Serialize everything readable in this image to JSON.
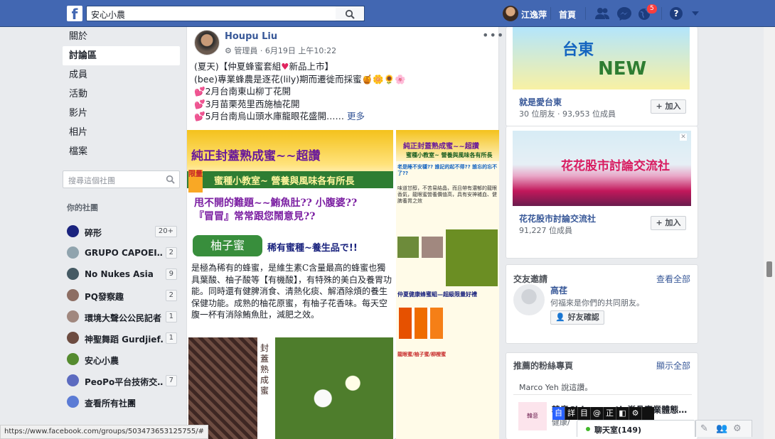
{
  "topbar": {
    "logo": "f",
    "search_value": "安心小農",
    "user_name": "江逸萍",
    "home_label": "首頁",
    "notification_count": "5",
    "help": "?"
  },
  "sidebar": {
    "items": [
      {
        "label": "關於"
      },
      {
        "label": "討論區"
      },
      {
        "label": "成員"
      },
      {
        "label": "活動"
      },
      {
        "label": "影片"
      },
      {
        "label": "相片"
      },
      {
        "label": "檔案"
      }
    ],
    "group_search_placeholder": "搜尋這個社團",
    "your_groups_title": "你的社團",
    "groups": [
      {
        "label": "碎形",
        "count": "20+",
        "color": "#1a237e"
      },
      {
        "label": "GRUPO CAPOEI…",
        "count": "2",
        "color": "#90a4ae"
      },
      {
        "label": "No Nukes Asia",
        "count": "9",
        "color": "#455a64"
      },
      {
        "label": "PQ發察趣",
        "count": "2",
        "color": "#8d6e63"
      },
      {
        "label": "環境大聲公公民記者",
        "count": "1",
        "color": "#a1887f"
      },
      {
        "label": "神聖舞蹈 Gurdjief…",
        "count": "1",
        "color": "#6d4c41"
      },
      {
        "label": "安心小農",
        "count": "",
        "color": "#558b2f"
      },
      {
        "label": "PeoPo平台技術交…",
        "count": "7",
        "color": "#5c6bc0"
      },
      {
        "label": "查看所有社團",
        "count": "",
        "color": "#5b7bd5"
      }
    ]
  },
  "post": {
    "author": "Houpu Liu",
    "role": "管理員",
    "date": "6月19日 上午10:22",
    "lines": [
      "(夏天)【仲夏蜂蜜套組",
      "新品上市】",
      "(bee)專業蜂農是逐花(lily)期而遷徙而採蜜🍯🌼🌻🌸",
      "2月台南東山柳丁花開",
      "3月苗栗苑里西施柚花開",
      "5月台南烏山頭水庫龍眼花盛開……"
    ],
    "more": "更多",
    "image": {
      "title": "純正封蓋熟成蜜~~超讚",
      "limit": "限量",
      "banner": "蜜種小教室~ 營養與風味各有所長",
      "line1": "甩不開的難題~~鮪魚肚?? 小腹婆??",
      "line2": "『冒冒』常常跟您鬧意見??",
      "tag": "柚子蜜",
      "rare": "稀有蜜種~養生品で!!",
      "body": "是極為稀有的蜂蜜，是維生素C含量最高的蜂蜜也獨具葉酸、柚子酸等【有機酸】，有特殊的美白及養胃功能。同時還有健脾消食、清熱化痰、解酒除煩的養生保健功能。成熟的柚花原蜜，有柚子花香味。每天空腹一杯有消除鮪魚肚，減肥之效。",
      "seal": "封蓋熟成蜜",
      "side_title": "純正封蓋熟成蜜~~超讚",
      "side_sub": "蜜種小教室~ 營養與風味各有所長",
      "side_q": "老是睡不安穩?? 誰記的起不得?? 誰忘的忘不了??",
      "side_body": "味道甘醇，不苦易結晶，而且帶有濃郁的龍眼香氣，龍眼蜜營養價值高，具有安神補血、健脾養胃之效",
      "side_title2": "仲夏健康蜂蜜組—超級限量好禮",
      "side_combo": "龍眼蜜/柚子蜜/柳橙蜜"
    }
  },
  "right": {
    "ads": [
      {
        "name": "就是愛台東",
        "sub": "30 位朋友 · 93,953 位成員",
        "add": "+ 加入",
        "banner_title": "台東",
        "banner_sub": "NEW"
      },
      {
        "name": "花花股市討論交流社",
        "sub": "91,227 位成員",
        "add": "+ 加入",
        "banner_title": "花花股市討論交流社"
      }
    ],
    "friend_invites": {
      "title": "交友邀請",
      "see_all": "查看全部",
      "name": "高荏",
      "desc": "何福來是你們的共同朋友。",
      "confirm": "好友確認"
    },
    "fan_pages": {
      "title": "推薦的粉絲專頁",
      "see_all": "顯示全部",
      "liked": "Marco Yeh 說這讚。",
      "page_name": "韓意Chiropractic脊骨專業體態…",
      "page_desc": "健康/",
      "thumb": "韓意"
    }
  },
  "ime": [
    "自",
    "詳",
    "目",
    "@",
    "正",
    "◧",
    "⚙"
  ],
  "chat": {
    "label": "聊天室(149)"
  },
  "status_url": "https://www.facebook.com/groups/503473653125755/#"
}
